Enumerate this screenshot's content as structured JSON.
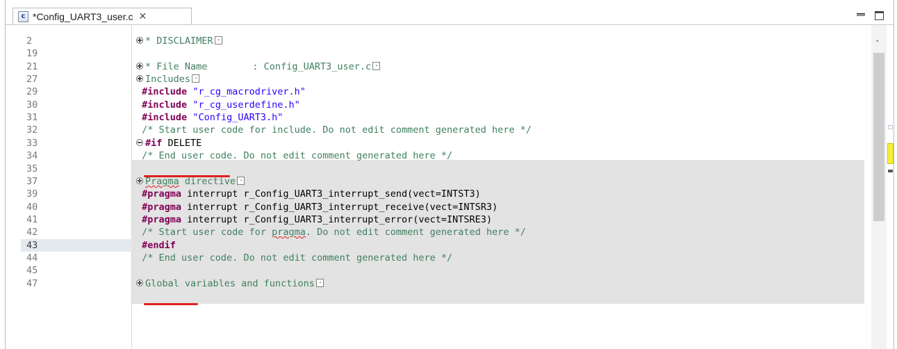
{
  "tab": {
    "icon_letter": "c",
    "label": "*Config_UART3_user.c",
    "close_symbol": "✕"
  },
  "window_buttons": [
    "minimize",
    "maximize"
  ],
  "current_line": "43",
  "lines": [
    {
      "num": "2",
      "html": "<span class='fold plus'></span><span class='cm'>* DISCLAIMER</span><span class='dots'></span>"
    },
    {
      "num": "19",
      "html": ""
    },
    {
      "num": "21",
      "html": "<span class='fold plus'></span><span class='cm'>* File Name        : Config_UART3_user.c</span><span class='dots'></span>"
    },
    {
      "num": "27",
      "html": "<span class='fold plus'></span><span class='cm'>Includes</span><span class='dots'></span>"
    },
    {
      "num": "29",
      "html": " <span class='kw'>#include</span> <span class='str'>\"r_cg_macrodriver.h\"</span>"
    },
    {
      "num": "30",
      "html": " <span class='kw'>#include</span> <span class='str'>\"r_cg_userdefine.h\"</span>"
    },
    {
      "num": "31",
      "html": " <span class='kw'>#include</span> <span class='str'>\"Config_UART3.h\"</span>"
    },
    {
      "num": "32",
      "html": " <span class='cm'>/* Start user code for include. Do not edit comment generated here */</span>"
    },
    {
      "num": "33",
      "html": "<span class='fold'></span><span class='kw'>#if</span> DELETE"
    },
    {
      "num": "34",
      "html": " <span class='cm'>/* End user code. Do not edit comment generated here */</span>"
    },
    {
      "num": "35",
      "html": ""
    },
    {
      "num": "37",
      "html": "<span class='fold plus'></span><span class='cm'><span class='sq'>Pragma</span> directive</span><span class='dots'></span>"
    },
    {
      "num": "39",
      "html": " <span class='kw'>#pragma</span> interrupt r_Config_UART3_interrupt_send(vect=INTST3)"
    },
    {
      "num": "40",
      "html": " <span class='kw'>#pragma</span> interrupt r_Config_UART3_interrupt_receive(vect=INTSR3)"
    },
    {
      "num": "41",
      "html": " <span class='kw'>#pragma</span> interrupt r_Config_UART3_interrupt_error(vect=INTSRE3)"
    },
    {
      "num": "42",
      "html": " <span class='cm'>/* Start user code for <span class='sq'>pragma</span>. Do not edit comment generated here */</span>"
    },
    {
      "num": "43",
      "html": " <span class='kw'>#endif</span>"
    },
    {
      "num": "44",
      "html": " <span class='cm'>/* End user code. Do not edit comment generated here */</span>"
    },
    {
      "num": "45",
      "html": ""
    },
    {
      "num": "47",
      "html": "<span class='fold plus'></span><span class='cm'>Global variables and functions</span><span class='dots'></span>"
    }
  ]
}
